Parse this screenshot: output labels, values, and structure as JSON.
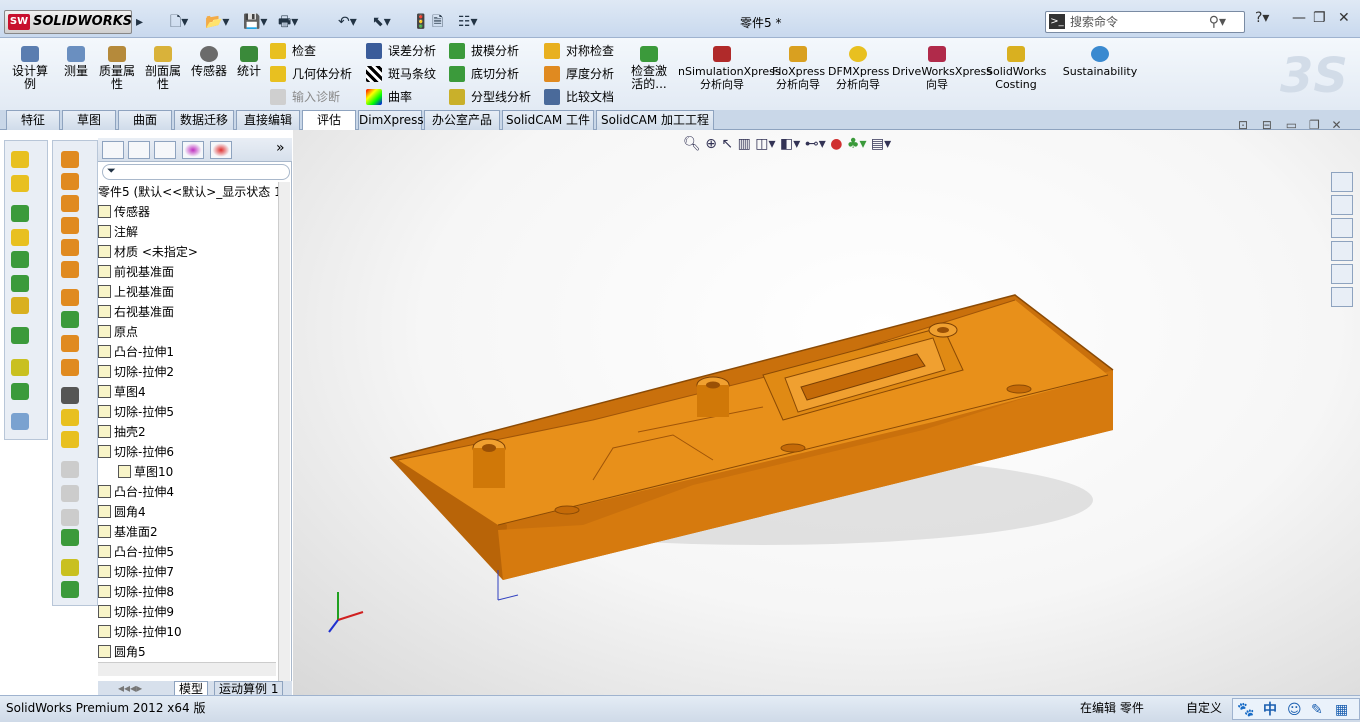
{
  "app": {
    "brand": "SOLIDWORKS",
    "brand_badge": "SW",
    "document_title": "零件5 *"
  },
  "search": {
    "placeholder": "搜索命令",
    "shortcut_label": ">_"
  },
  "command_manager": {
    "big_buttons": [
      {
        "label": "设计算例",
        "icon": "design-study-icon"
      },
      {
        "label": "测量",
        "icon": "measure-icon"
      },
      {
        "label": "质量属性",
        "icon": "mass-properties-icon"
      },
      {
        "label": "剖面属性",
        "icon": "section-properties-icon"
      },
      {
        "label": "传感器",
        "icon": "sensor-icon"
      },
      {
        "label": "统计",
        "icon": "statistics-icon"
      },
      {
        "label": "检查激活的...",
        "icon": "check-active-icon"
      },
      {
        "label": "nSimulationXpress 分析向导",
        "icon": "simulationxpress-icon"
      },
      {
        "label": "FloXpress 分析向导",
        "icon": "floxpress-icon"
      },
      {
        "label": "DFMXpress 分析向导",
        "icon": "dfmxpress-icon"
      },
      {
        "label": "DriveWorksXpress 向导",
        "icon": "driveworksxpress-icon"
      },
      {
        "label": "SolidWorks Costing",
        "icon": "costing-icon"
      },
      {
        "label": "Sustainability",
        "icon": "sustainability-icon"
      }
    ],
    "small_buttons": [
      {
        "label": "检查"
      },
      {
        "label": "几何体分析"
      },
      {
        "label": "输入诊断"
      },
      {
        "label": "误差分析"
      },
      {
        "label": "斑马条纹"
      },
      {
        "label": "曲率"
      },
      {
        "label": "拔模分析"
      },
      {
        "label": "底切分析"
      },
      {
        "label": "分型线分析"
      },
      {
        "label": "对称检查"
      },
      {
        "label": "厚度分析"
      },
      {
        "label": "比较文档"
      }
    ]
  },
  "tabs": [
    "特征",
    "草图",
    "曲面",
    "数据迁移",
    "直接编辑",
    "评估",
    "DimXpress",
    "办公室产品",
    "SolidCAM 工件",
    "SolidCAM 加工工程"
  ],
  "active_tab": "评估",
  "feature_tree": {
    "root": "零件5 (默认<<默认>_显示状态 1",
    "items": [
      "传感器",
      "注解",
      "材质 <未指定>",
      "前视基准面",
      "上视基准面",
      "右视基准面",
      "原点",
      "凸台-拉伸1",
      "切除-拉伸2",
      "草图4",
      "切除-拉伸5",
      "抽壳2",
      "切除-拉伸6",
      "草图10",
      "凸台-拉伸4",
      "圆角4",
      "基准面2",
      "凸台-拉伸5",
      "切除-拉伸7",
      "切除-拉伸8",
      "切除-拉伸9",
      "切除-拉伸10",
      "圆角5"
    ]
  },
  "bottom_tabs": [
    "模型",
    "运动算例 1"
  ],
  "status": {
    "product": "SolidWorks Premium 2012 x64 版",
    "mode": "在编辑 零件",
    "units": "自定义"
  },
  "ime": {
    "label": "中"
  },
  "colors": {
    "accent": "#c8102e",
    "part": "#e08a10"
  }
}
